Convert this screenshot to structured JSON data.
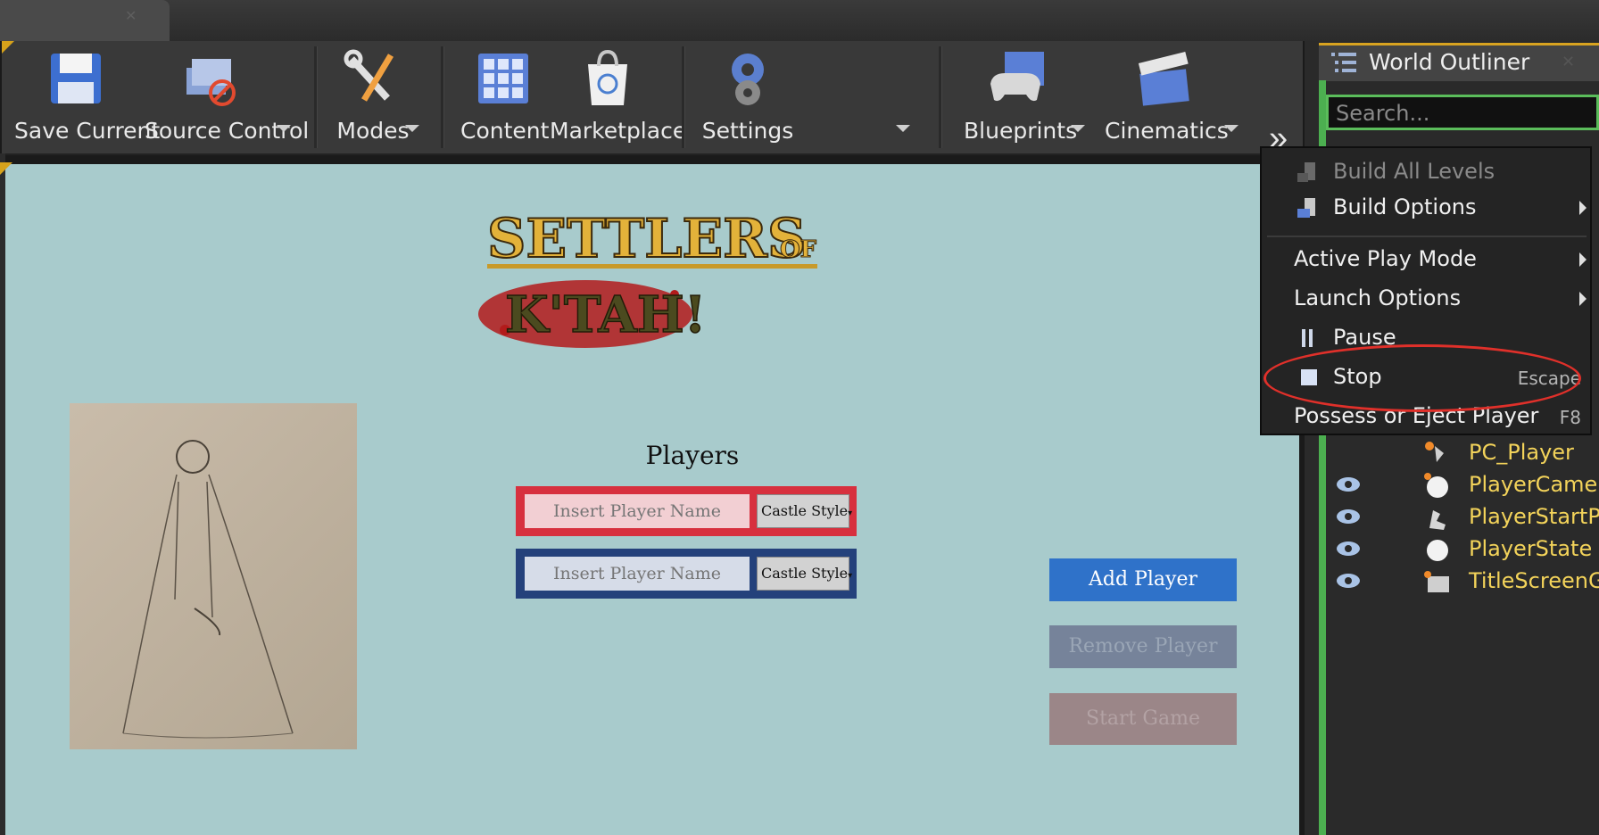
{
  "toolbar": {
    "buttons": [
      {
        "label": "Save Current",
        "icon": "floppy-disk-icon"
      },
      {
        "label": "Source Control",
        "icon": "source-control-icon"
      },
      {
        "label": "Modes",
        "icon": "modes-tools-icon"
      },
      {
        "label": "Content",
        "icon": "content-grid-icon"
      },
      {
        "label": "Marketplace",
        "icon": "marketplace-bag-icon"
      },
      {
        "label": "Settings",
        "icon": "settings-gears-icon"
      },
      {
        "label": "Blueprints",
        "icon": "blueprints-gamepad-icon"
      },
      {
        "label": "Cinematics",
        "icon": "cinematics-clapper-icon"
      }
    ],
    "more_icon": "double-chevron-right-icon"
  },
  "game": {
    "logo_line1": "SETTLERS",
    "logo_of": "OF",
    "logo_line2": "K'TAH!",
    "players_title": "Players",
    "name_placeholder": "Insert Player Name",
    "castle_style": "Castle Style",
    "add_player": "Add Player",
    "remove_player": "Remove Player",
    "start_game": "Start Game",
    "colors": {
      "player1": "#d7303e",
      "player2": "#24417b",
      "add": "#2f72c9"
    }
  },
  "outliner": {
    "title": "World Outliner",
    "search_placeholder": "Search...",
    "rows": [
      "PC_Player",
      "PlayerCameraM",
      "PlayerStartPIE",
      "PlayerState",
      "TitleScreenGam"
    ]
  },
  "menu": {
    "build_all_levels": "Build All Levels",
    "build_options": "Build Options",
    "active_play_mode": "Active Play Mode",
    "launch_options": "Launch Options",
    "pause": "Pause",
    "stop": "Stop",
    "stop_shortcut": "Escape",
    "possess": "Possess or Eject Player",
    "possess_shortcut": "F8"
  },
  "accent_color": "#d8a320"
}
